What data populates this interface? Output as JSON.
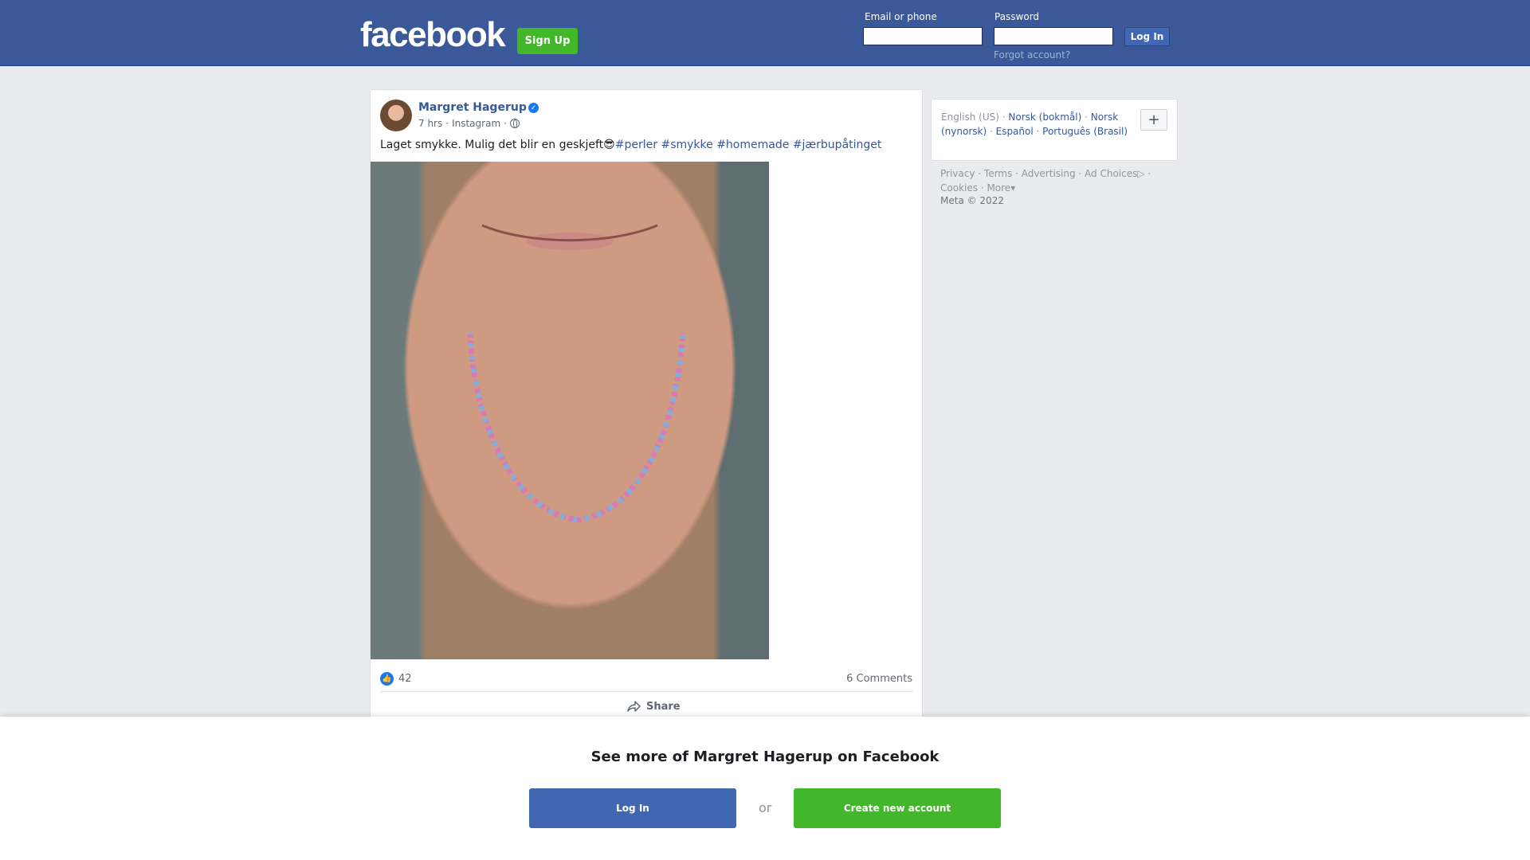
{
  "header": {
    "logo": "facebook",
    "signup_label": "Sign Up",
    "email_label": "Email or phone",
    "password_label": "Password",
    "login_label": "Log In",
    "forgot_label": "Forgot account?"
  },
  "post": {
    "author": "Margret Hagerup",
    "time": "7 hrs",
    "source": "Instagram",
    "text": "Laget smykke. Mulig det blir en geskjeft😎",
    "hashtags": [
      "#perler",
      "#smykke",
      "#homemade",
      "#jærbupåtinget"
    ],
    "likes": "42",
    "comments": "6 Comments",
    "share_label": "Share"
  },
  "sidebar": {
    "languages": {
      "current": "English (US)",
      "others": [
        "Norsk (bokmål)",
        "Norsk (nynorsk)",
        "Español",
        "Português (Brasil)"
      ],
      "add_symbol": "+"
    },
    "footer_links": [
      "Privacy",
      "Terms",
      "Advertising",
      "Ad Choices",
      "Cookies",
      "More"
    ],
    "copyright": "Meta © 2022"
  },
  "overlay": {
    "title": "See more of Margret Hagerup on Facebook",
    "login_label": "Log In",
    "or_label": "or",
    "create_label": "Create new account"
  },
  "colors": {
    "brand_blue": "#3b5998",
    "button_blue": "#4267b2",
    "green": "#42b72a",
    "link": "#365899"
  }
}
